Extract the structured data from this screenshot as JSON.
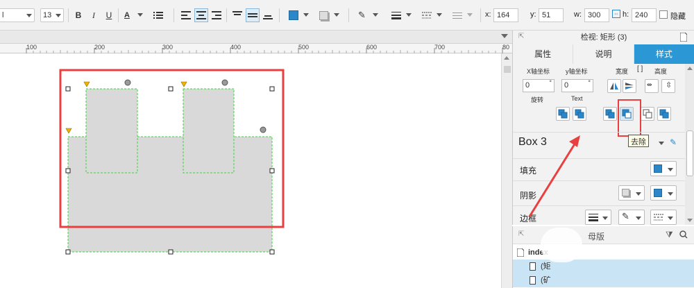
{
  "toolbar": {
    "font_family": "l",
    "font_size": "13",
    "bold": "B",
    "italic": "I",
    "underline": "U",
    "font_color": "A",
    "x_label": "x:",
    "x_value": "164",
    "y_label": "y:",
    "y_value": "51",
    "w_label": "w:",
    "w_value": "300",
    "h_label": "h:",
    "h_value": "240",
    "hide_label": "隐藏",
    "accent": "#2b87c8"
  },
  "ruler": {
    "labels": [
      "100",
      "200",
      "300",
      "400",
      "500",
      "600",
      "700",
      "80"
    ]
  },
  "panel": {
    "title": "检视: 矩形 (3)",
    "tabs": [
      "属性",
      "说明",
      "样式"
    ],
    "active_tab": "样式",
    "x_axis_label": "X轴坐标",
    "y_axis_label": "y轴坐标",
    "width_label": "宽度",
    "height_label": "高度",
    "x_axis_value": "0",
    "y_axis_value": "0",
    "rotate_label": "旋转",
    "text_label": "Text",
    "tooltip": "去除",
    "shape_name": "Box 3",
    "fill_label": "填充",
    "shadow_label": "阴影",
    "border_label": "边框"
  },
  "outline": {
    "title": "母版",
    "root": "index",
    "items": [
      "(矩",
      "(矿"
    ]
  }
}
